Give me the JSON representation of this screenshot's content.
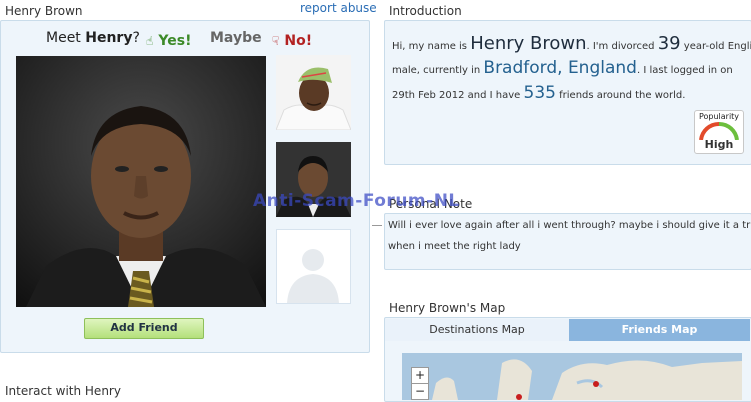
{
  "profile": {
    "name_title": "Henry Brown",
    "report_link": "report abuse",
    "meet_prefix": "Meet ",
    "meet_name": "Henry",
    "meet_suffix": "?",
    "yes_label": "Yes!",
    "maybe_label": "Maybe",
    "no_label": "No!",
    "add_friend_label": "Add Friend",
    "interact_label": "Interact with Henry"
  },
  "introduction": {
    "title": "Introduction",
    "t1": "Hi, my name is ",
    "name": "Henry Brown",
    "t2": ". I'm divorced ",
    "age": "39",
    "t3": " year-old English",
    "t4": "male, currently in ",
    "location": "Bradford, England",
    "t5": ". I last logged in on",
    "t6": "29th Feb 2012 and I have ",
    "friends": "535",
    "t7": " friends around the world.",
    "popularity_label": "Popularity",
    "popularity_value": "High"
  },
  "note": {
    "title": "Personal Note",
    "line1": "Will i ever love again after all i went through? maybe i should give it a trial",
    "line2": "when i meet the right lady"
  },
  "map": {
    "title": "Henry Brown's Map",
    "tabs": [
      "Destinations Map",
      "Friends Map"
    ],
    "zoom_in": "+",
    "zoom_out": "−"
  },
  "watermark": "Anti-Scam-Forum-NL",
  "colors": {
    "panel_bg": "#eef5fb",
    "panel_border": "#c9dcea",
    "link": "#2a6db5",
    "yes": "#3c8a28",
    "no": "#b32222",
    "active_tab": "#8ab5de"
  }
}
